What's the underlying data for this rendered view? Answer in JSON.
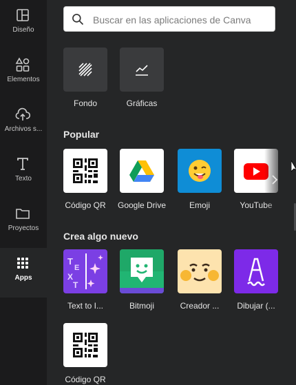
{
  "sidebar": {
    "items": [
      {
        "label": "Diseño",
        "icon": "layout-icon"
      },
      {
        "label": "Elementos",
        "icon": "shapes-icon"
      },
      {
        "label": "Archivos s...",
        "icon": "upload-cloud-icon"
      },
      {
        "label": "Texto",
        "icon": "text-icon"
      },
      {
        "label": "Proyectos",
        "icon": "folder-icon"
      },
      {
        "label": "Apps",
        "icon": "apps-grid-icon"
      }
    ]
  },
  "search": {
    "placeholder": "Buscar en las aplicaciones de Canva"
  },
  "tools": [
    {
      "label": "Fondo",
      "icon": "background-hatch-icon"
    },
    {
      "label": "Gráficas",
      "icon": "chart-line-icon"
    }
  ],
  "popular": {
    "title": "Popular",
    "apps": [
      {
        "label": "Código QR",
        "icon": "qr-code-icon"
      },
      {
        "label": "Google Drive",
        "icon": "google-drive-icon"
      },
      {
        "label": "Emoji",
        "icon": "emoji-icon"
      },
      {
        "label": "YouTube",
        "icon": "youtube-icon"
      }
    ]
  },
  "create": {
    "title": "Crea algo nuevo",
    "apps": [
      {
        "label": "Text to I...",
        "icon": "text-to-image-icon"
      },
      {
        "label": "Bitmoji",
        "icon": "bitmoji-icon"
      },
      {
        "label": "Creador ...",
        "icon": "character-creator-icon"
      },
      {
        "label": "Dibujar (...",
        "icon": "draw-icon"
      },
      {
        "label": "Código QR",
        "icon": "qr-code-icon"
      }
    ]
  },
  "colors": {
    "sidebar_bg": "#1b1b1c",
    "panel_bg": "#252627",
    "youtube_red": "#ff0000",
    "emoji_bg": "#0f8dd6",
    "text_to_image_bg": "#7b3fe4",
    "bitmoji_bg": "#21b573",
    "creator_bg": "#fde3ae",
    "draw_bg": "#7d2ae8"
  }
}
